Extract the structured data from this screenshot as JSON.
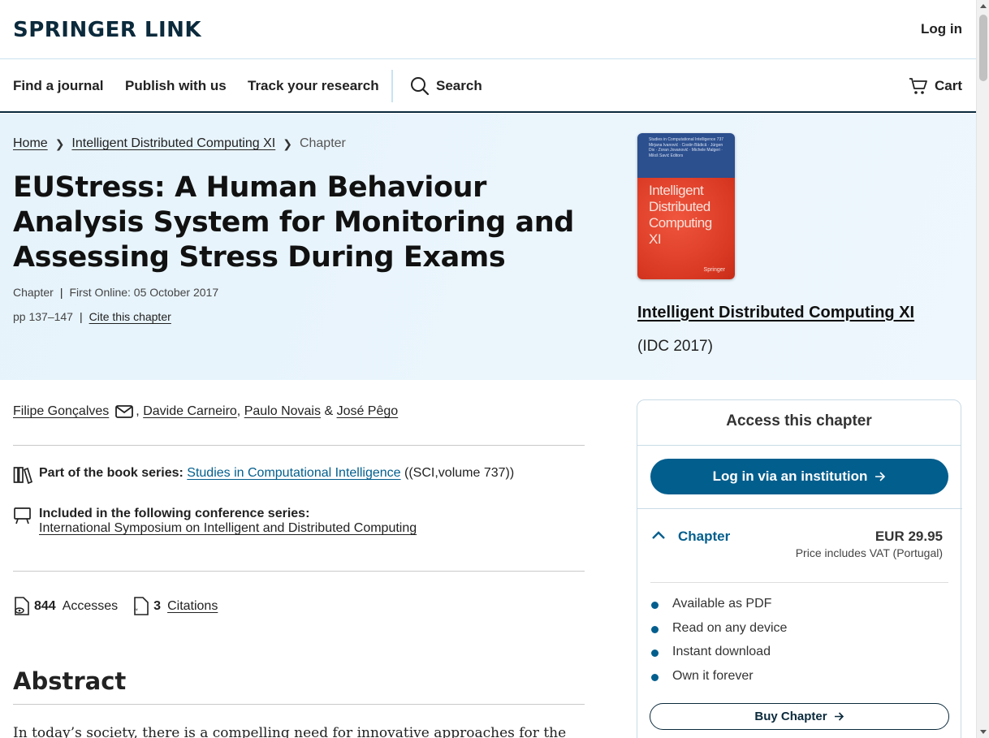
{
  "header": {
    "logo": "SPRINGER LINK",
    "login": "Log in"
  },
  "nav": {
    "items": [
      "Find a journal",
      "Publish with us",
      "Track your research"
    ],
    "search": "Search",
    "cart": "Cart"
  },
  "breadcrumb": {
    "home": "Home",
    "book": "Intelligent Distributed Computing XI",
    "current": "Chapter"
  },
  "article": {
    "title": "EUStress: A Human Behaviour Analysis System for Monitoring and Assessing Stress During Exams",
    "type": "Chapter",
    "first_online": "First Online: 05 October 2017",
    "pages": "pp 137–147",
    "cite": "Cite this chapter"
  },
  "book": {
    "cover_series": "Studies in Computational Intelligence 737",
    "cover_editors": "Mirjana Ivanović · Costin Bădică · Jürgen Dix · Zoran Jovanović · Michele Malgeri · Miloš Savić Editors",
    "cover_title": "Intelligent Distributed Computing XI",
    "cover_publisher": "Springer",
    "title": "Intelligent Distributed Computing XI",
    "subtitle": "(IDC 2017)"
  },
  "authors": {
    "list": [
      "Filipe Gonçalves",
      "Davide Carneiro",
      "Paulo Novais",
      "José Pêgo"
    ],
    "sep1": ",",
    "sep2": ",",
    "sep3": "&"
  },
  "series": {
    "label": "Part of the book series:",
    "name": "Studies in Computational Intelligence",
    "suffix": "((SCI,volume 737))"
  },
  "conference": {
    "label": "Included in the following conference series:",
    "name": "International Symposium on Intelligent and Distributed Computing"
  },
  "metrics": {
    "accesses_count": "844",
    "accesses_label": "Accesses",
    "citations_count": "3",
    "citations_label": "Citations"
  },
  "abstract": {
    "heading": "Abstract",
    "text_start": "In today’s society, there is a compelling need for innovative approaches for the"
  },
  "access_panel": {
    "heading": "Access this chapter",
    "institution_button": "Log in via an institution",
    "item_label": "Chapter",
    "price": "EUR 29.95",
    "vat": "Price includes VAT (Portugal)",
    "benefits": [
      "Available as PDF",
      "Read on any device",
      "Instant download",
      "Own it forever"
    ],
    "buy_button": "Buy Chapter"
  },
  "colors": {
    "brand_dark": "#0b2a3c",
    "link_blue": "#025e8d",
    "hero_bg": "#e8f4fb",
    "cover_red": "#d93923",
    "cover_blue": "#2c4f8e"
  }
}
